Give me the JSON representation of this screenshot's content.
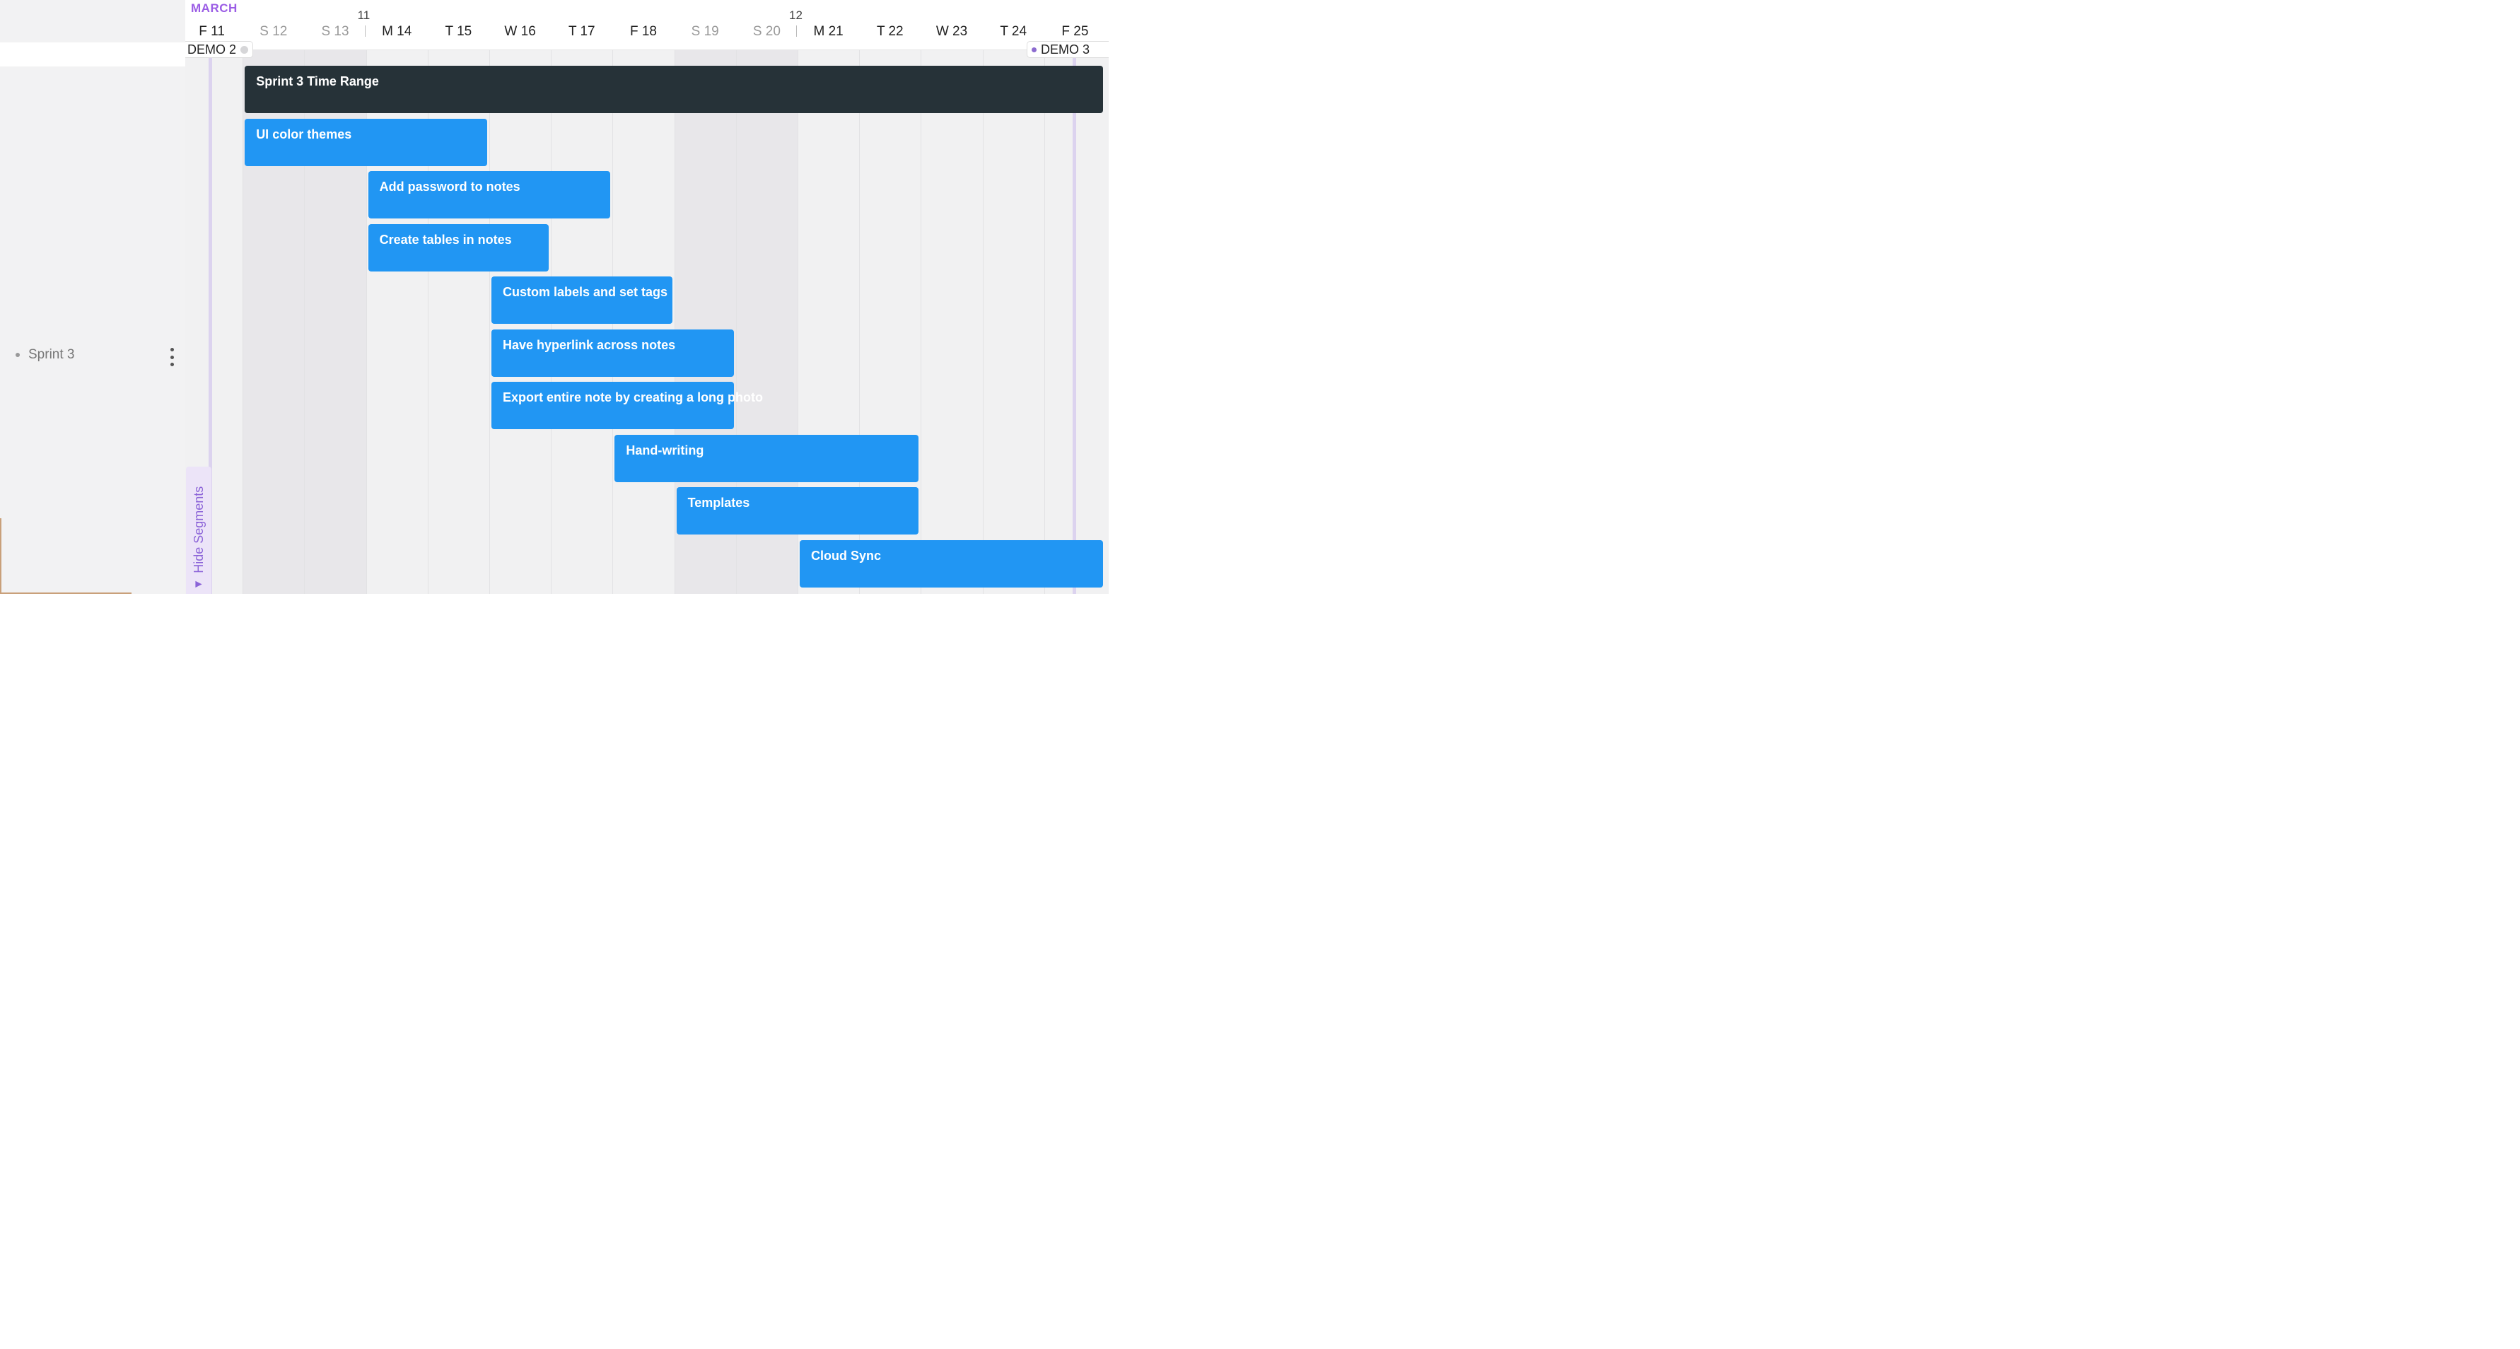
{
  "sidebar": {
    "item_label": "Sprint 3"
  },
  "timeline": {
    "month": "MARCH",
    "weeks": [
      {
        "number": "11",
        "col": 3
      },
      {
        "number": "12",
        "col": 10
      }
    ],
    "days": [
      {
        "label": "F 11",
        "weekend": false
      },
      {
        "label": "S 12",
        "weekend": true
      },
      {
        "label": "S 13",
        "weekend": true
      },
      {
        "label": "M 14",
        "weekend": false
      },
      {
        "label": "T 15",
        "weekend": false
      },
      {
        "label": "W 16",
        "weekend": false
      },
      {
        "label": "T 17",
        "weekend": false
      },
      {
        "label": "F 18",
        "weekend": false
      },
      {
        "label": "S 19",
        "weekend": true
      },
      {
        "label": "S 20",
        "weekend": true
      },
      {
        "label": "M 21",
        "weekend": false
      },
      {
        "label": "T 22",
        "weekend": false
      },
      {
        "label": "W 23",
        "weekend": false
      },
      {
        "label": "T 24",
        "weekend": false
      },
      {
        "label": "F 25",
        "weekend": false
      }
    ],
    "milestones": {
      "demo2": "DEMO 2",
      "demo3": "DEMO 3"
    },
    "hide_segments_label": "Hide Segments"
  },
  "tasks": [
    {
      "name": "Sprint 3 Time Range",
      "start": 1,
      "end": 15,
      "kind": "range"
    },
    {
      "name": "UI color themes",
      "start": 1,
      "end": 5,
      "kind": "task"
    },
    {
      "name": "Add password to notes",
      "start": 3,
      "end": 7,
      "kind": "task"
    },
    {
      "name": "Create tables in notes",
      "start": 3,
      "end": 6,
      "kind": "task"
    },
    {
      "name": "Custom labels and set tags",
      "start": 5,
      "end": 8,
      "kind": "task"
    },
    {
      "name": "Have hyperlink across notes",
      "start": 5,
      "end": 9,
      "kind": "task"
    },
    {
      "name": "Export entire note by creating a long photo",
      "start": 5,
      "end": 9,
      "kind": "task"
    },
    {
      "name": "Hand-writing",
      "start": 7,
      "end": 12,
      "kind": "task"
    },
    {
      "name": "Templates",
      "start": 8,
      "end": 12,
      "kind": "task"
    },
    {
      "name": "Cloud Sync",
      "start": 10,
      "end": 15,
      "kind": "task"
    }
  ],
  "colors": {
    "task": "#2196f3",
    "range": "#263238",
    "accent": "#9b5de5"
  }
}
